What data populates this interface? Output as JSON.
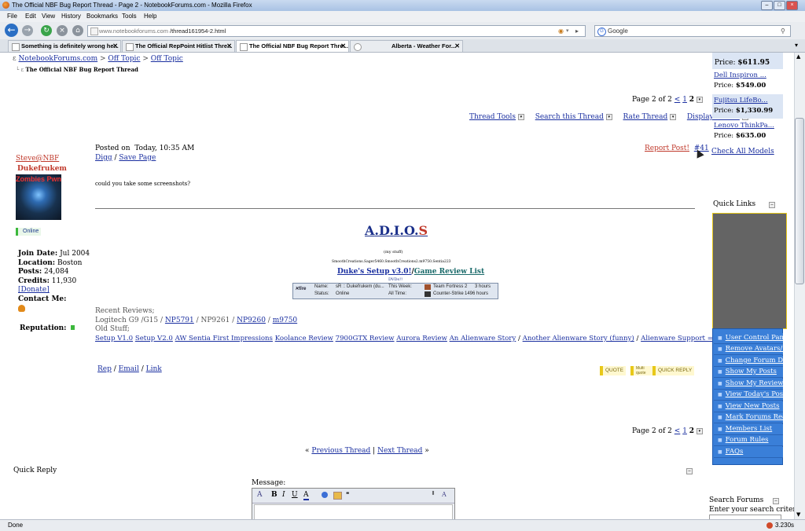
{
  "window": {
    "title": "The Official NBF Bug Report Thread - Page 2 - NotebookForums.com - Mozilla Firefox"
  },
  "menu": [
    "File",
    "Edit",
    "View",
    "History",
    "Bookmarks",
    "Tools",
    "Help"
  ],
  "nav": {
    "url_domain": "www.notebookforums.com",
    "url_path": "/thread161954-2.html",
    "search_value": "Google"
  },
  "tabs": [
    {
      "label": "Something is definitely wrong he...",
      "active": false
    },
    {
      "label": "The Official RepPoint Hitlist Thre...",
      "active": false
    },
    {
      "label": "The Official NBF Bug Report Thre...",
      "active": true
    },
    {
      "label": "Alberta - Weather For...",
      "active": false
    }
  ],
  "breadcrumb": {
    "site": "NotebookForums.com",
    "sep": ">",
    "cat1": "Off Topic",
    "cat2": "Off Topic",
    "thread": "The Official NBF Bug Report Thread"
  },
  "pagination": {
    "text": "Page 2 of 2",
    "prev": "<",
    "p1": "1",
    "p2": "2"
  },
  "thread_tools": [
    "Thread Tools",
    "Search this Thread",
    "Rate Thread",
    "Display Modes"
  ],
  "post": {
    "posted_label": "Posted on",
    "posted_time": "Today, 10:35 AM",
    "digg": "Digg",
    "slash": "/",
    "save_page": "Save Page",
    "report": "Report Post!",
    "number": "#41",
    "body": "could you take some screenshots?",
    "rep": "Rep",
    "email": "Email",
    "link": "Link",
    "quote_btn": "QUOTE",
    "multi_btn": "Multi quote",
    "quick_btn": "QUICK REPLY"
  },
  "user": {
    "name": "Steve@NBF",
    "title": "Dukefrukem",
    "avatar_text": "Zombies Pwn",
    "status": "Online",
    "join_label": "Join Date:",
    "join": "Jul 2004",
    "location_label": "Location:",
    "location": "Boston",
    "posts_label": "Posts:",
    "posts": "24,084",
    "credits_label": "Credits:",
    "credits": "11,930",
    "donate": "[Donate]",
    "contact_label": "Contact Me:",
    "reputation_label": "Reputation:"
  },
  "signature": {
    "adios": [
      "A",
      ".",
      "D",
      ".",
      "I",
      ".",
      "O",
      ".",
      "S"
    ],
    "my_stuff": "(my stuff)",
    "line_small": "SmoothCreations.Sager5460.SmoothCreations2.m9750.Sentia223",
    "setup": "Duke's Setup v3.0!",
    "game_review": "Game Review List",
    "dvds": "DVDs!!",
    "xfire_name_label": "Name:",
    "xfire_name": "sR :: Dukefrukem (du...",
    "xfire_status_label": "Status:",
    "xfire_status": "Online",
    "xfire_week_label": "This Week:",
    "xfire_all_label": "All Time:",
    "game1": "Team Fortress 2",
    "game1_time": "3 hours",
    "game2": "Counter-Strike",
    "game2_time": "1496 hours",
    "recent_label": "Recent Reviews;",
    "recent_items": [
      "Logitech G9 /G15 /",
      "NP5791",
      " / NP9261 / ",
      "NP9260",
      " / ",
      "m9750"
    ],
    "old_label": "Old Stuff;",
    "old_links": [
      "Setup V1.0",
      "Setup V2.0",
      "AW Sentia First Impressions",
      "Koolance Review",
      "7900GTX Review",
      "Aurora Review",
      "An Alienware Story",
      "Another Alienware Story (funny)",
      "Alienware Support = A+"
    ]
  },
  "thread_nav": {
    "prev": "Previous Thread",
    "sep": "|",
    "next": "Next Thread",
    "lq": "«",
    "rq": "»"
  },
  "quick_reply": {
    "title": "Quick Reply",
    "message_label": "Message:"
  },
  "sidebar": {
    "products": [
      {
        "name": "",
        "price_label": "Price:",
        "price": "$611.95"
      },
      {
        "name": "Dell Inspiron ...",
        "price_label": "Price:",
        "price": "$549.00"
      },
      {
        "name": "Fujitsu LifeBo...",
        "price_label": "Price:",
        "price": "$1,330.99"
      },
      {
        "name": "Lenovo ThinkPa...",
        "price_label": "Price:",
        "price": "$635.00"
      }
    ],
    "check_all": "Check All Models",
    "quick_links_title": "Quick Links",
    "quick_links": [
      "User Control Panel",
      "Remove Avatars/Sigs",
      "Change Forum Display",
      "Show My Posts",
      "Show My Reviews",
      "View Today's Posts",
      "View New Posts",
      "Mark Forums Read",
      "Members List",
      "Forum Rules",
      "FAQs"
    ],
    "search_title": "Search Forums",
    "search_prompt": "Enter your search criteria:"
  },
  "status": {
    "text": "Done",
    "timer": "3.230s"
  }
}
